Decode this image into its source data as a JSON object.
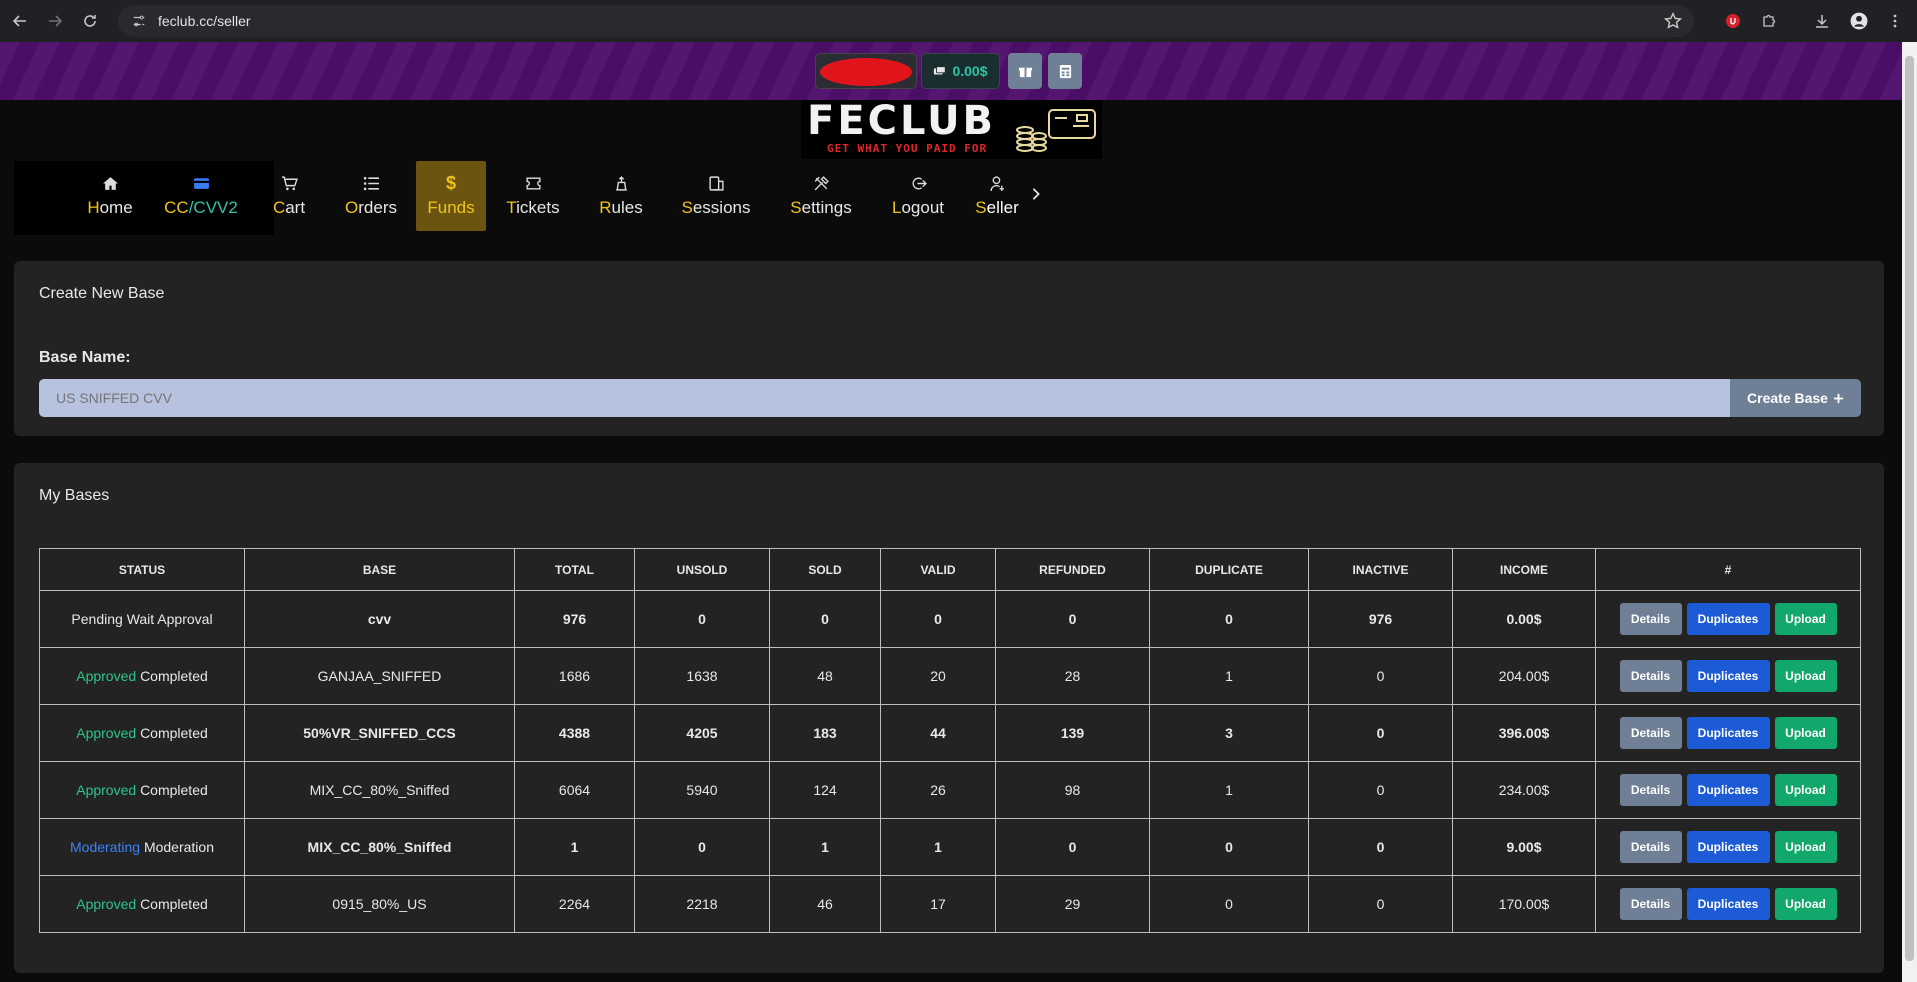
{
  "browser": {
    "url": "feclub.cc/seller"
  },
  "topbar": {
    "balance": "0.00$"
  },
  "logo": {
    "title": "FECLUB",
    "tagline": "GET WHAT YOU PAID FOR"
  },
  "nav": {
    "items": [
      {
        "first": "H",
        "rest": "ome",
        "icon": "home-icon"
      },
      {
        "first": "CC",
        "rest": "/CVV2",
        "icon": "credit-card-icon"
      },
      {
        "first": "C",
        "rest": "art",
        "icon": "cart-icon"
      },
      {
        "first": "O",
        "rest": "rders",
        "icon": "list-icon"
      },
      {
        "first": "F",
        "rest": "unds",
        "icon": "dollar-icon"
      },
      {
        "first": "T",
        "rest": "ickets",
        "icon": "ticket-icon"
      },
      {
        "first": "R",
        "rest": "ules",
        "icon": "rules-icon"
      },
      {
        "first": "S",
        "rest": "essions",
        "icon": "sessions-icon"
      },
      {
        "first": "S",
        "rest": "ettings",
        "icon": "tools-icon"
      },
      {
        "first": "L",
        "rest": "ogout",
        "icon": "logout-icon"
      },
      {
        "first": "S",
        "rest": "eller",
        "icon": "seller-icon"
      }
    ]
  },
  "create": {
    "title": "Create New Base",
    "label": "Base Name:",
    "placeholder": "US SNIFFED CVV",
    "button": "Create Base"
  },
  "bases": {
    "title": "My Bases",
    "headers": [
      "STATUS",
      "BASE",
      "TOTAL",
      "UNSOLD",
      "SOLD",
      "VALID",
      "REFUNDED",
      "DUPLICATE",
      "INACTIVE",
      "INCOME",
      "#"
    ],
    "actions": {
      "details": "Details",
      "duplicates": "Duplicates",
      "upload": "Upload"
    },
    "rows": [
      {
        "status1": "Pending",
        "status2": "Wait Approval",
        "tone": "neutral",
        "base": "cvv",
        "total": "976",
        "unsold": "0",
        "sold": "0",
        "valid": "0",
        "refunded": "0",
        "duplicate": "0",
        "inactive": "976",
        "income": "0.00$"
      },
      {
        "status1": "Approved",
        "status2": "Completed",
        "tone": "green",
        "base": "GANJAA_SNIFFED",
        "total": "1686",
        "unsold": "1638",
        "sold": "48",
        "valid": "20",
        "refunded": "28",
        "duplicate": "1",
        "inactive": "0",
        "income": "204.00$"
      },
      {
        "status1": "Approved",
        "status2": "Completed",
        "tone": "green",
        "base": "50%VR_SNIFFED_CCS",
        "total": "4388",
        "unsold": "4205",
        "sold": "183",
        "valid": "44",
        "refunded": "139",
        "duplicate": "3",
        "inactive": "0",
        "income": "396.00$"
      },
      {
        "status1": "Approved",
        "status2": "Completed",
        "tone": "green",
        "base": "MIX_CC_80%_Sniffed",
        "total": "6064",
        "unsold": "5940",
        "sold": "124",
        "valid": "26",
        "refunded": "98",
        "duplicate": "1",
        "inactive": "0",
        "income": "234.00$"
      },
      {
        "status1": "Moderating",
        "status2": "Moderation",
        "tone": "blue",
        "base": "MIX_CC_80%_Sniffed",
        "total": "1",
        "unsold": "0",
        "sold": "1",
        "valid": "1",
        "refunded": "0",
        "duplicate": "0",
        "inactive": "0",
        "income": "9.00$"
      },
      {
        "status1": "Approved",
        "status2": "Completed",
        "tone": "green",
        "base": "0915_80%_US",
        "total": "2264",
        "unsold": "2218",
        "sold": "46",
        "valid": "17",
        "refunded": "29",
        "duplicate": "0",
        "inactive": "0",
        "income": "170.00$"
      }
    ]
  }
}
